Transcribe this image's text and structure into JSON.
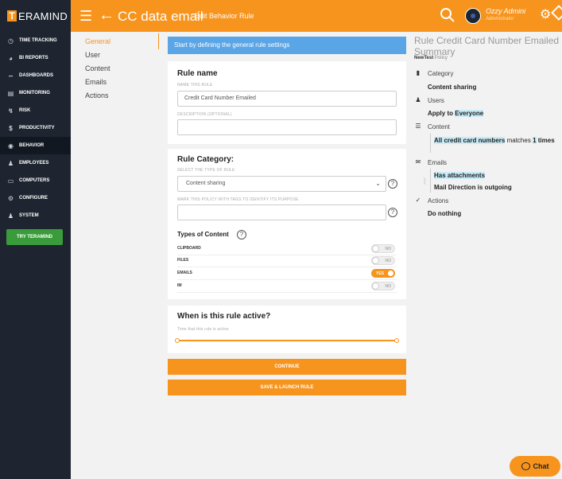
{
  "brand": {
    "logo_letter": "T",
    "name": "ERAMIND"
  },
  "header": {
    "title": "CC data email",
    "subtitle": "Edit Behavior Rule",
    "user_name": "Ozzy Admini",
    "user_role": "Administrator"
  },
  "sidebar": {
    "items": [
      {
        "label": "TIME TRACKING",
        "icon": "clock-icon"
      },
      {
        "label": "BI REPORTS",
        "icon": "pie-chart-icon"
      },
      {
        "label": "DASHBOARDS",
        "icon": "line-chart-icon"
      },
      {
        "label": "MONITORING",
        "icon": "document-icon"
      },
      {
        "label": "RISK",
        "icon": "bolt-icon"
      },
      {
        "label": "PRODUCTIVITY",
        "icon": "dollar-icon"
      },
      {
        "label": "BEHAVIOR",
        "icon": "mask-icon"
      },
      {
        "label": "EMPLOYEES",
        "icon": "person-icon"
      },
      {
        "label": "COMPUTERS",
        "icon": "monitor-icon"
      },
      {
        "label": "CONFIGURE",
        "icon": "gear-icon"
      },
      {
        "label": "SYSTEM",
        "icon": "person-gear-icon"
      }
    ],
    "active_index": 6,
    "try_button": "TRY TERAMIND"
  },
  "steps": [
    "General",
    "User",
    "Content",
    "Emails",
    "Actions"
  ],
  "form": {
    "banner": "Start by defining the general rule settings",
    "rule_name": {
      "title": "Rule name",
      "name_label": "NAME THIS RULE",
      "name_value": "Credit Card Number Emailed",
      "description_label": "DESCRIPTION (OPTIONAL)",
      "description_value": ""
    },
    "rule_category": {
      "title": "Rule Category:",
      "type_label": "SELECT THE TYPE OF RULE",
      "type_value": "Content sharing",
      "tags_label": "MARK THIS POLICY WITH TAGS TO IDENTIFY ITS PURPOSE",
      "tags_value": "",
      "types_title": "Types of Content",
      "types": [
        {
          "label": "CLIPBOARD",
          "state": "NO",
          "on": false
        },
        {
          "label": "FILES",
          "state": "NO",
          "on": false
        },
        {
          "label": "EMAILS",
          "state": "YES",
          "on": true
        },
        {
          "label": "IM",
          "state": "NO",
          "on": false
        }
      ]
    },
    "active": {
      "title": "When is this rule active?",
      "label": "Time that this rule is active",
      "range": [
        0,
        1
      ]
    },
    "continue_button": "CONTINUE",
    "launch_button": "SAVE & LAUNCH RULE"
  },
  "summary": {
    "title": "Rule Credit Card Number Emailed Summary",
    "policy_name": "NewTest",
    "policy_word": "Policy",
    "category_head": "Category",
    "category_value": "Content sharing",
    "users_head": "Users",
    "users_prefix": "Apply to",
    "users_value": "Everyone",
    "content_head": "Content",
    "content_value": "All credit card numbers",
    "content_matches": "matches",
    "content_count": "1",
    "content_times": "times",
    "emails_head": "Emails",
    "emails_and": "AND",
    "emails_value1": "Has attachments",
    "emails_value2": "Mail Direction is outgoing",
    "actions_head": "Actions",
    "actions_value": "Do nothing"
  },
  "chat": {
    "label": "Chat"
  }
}
